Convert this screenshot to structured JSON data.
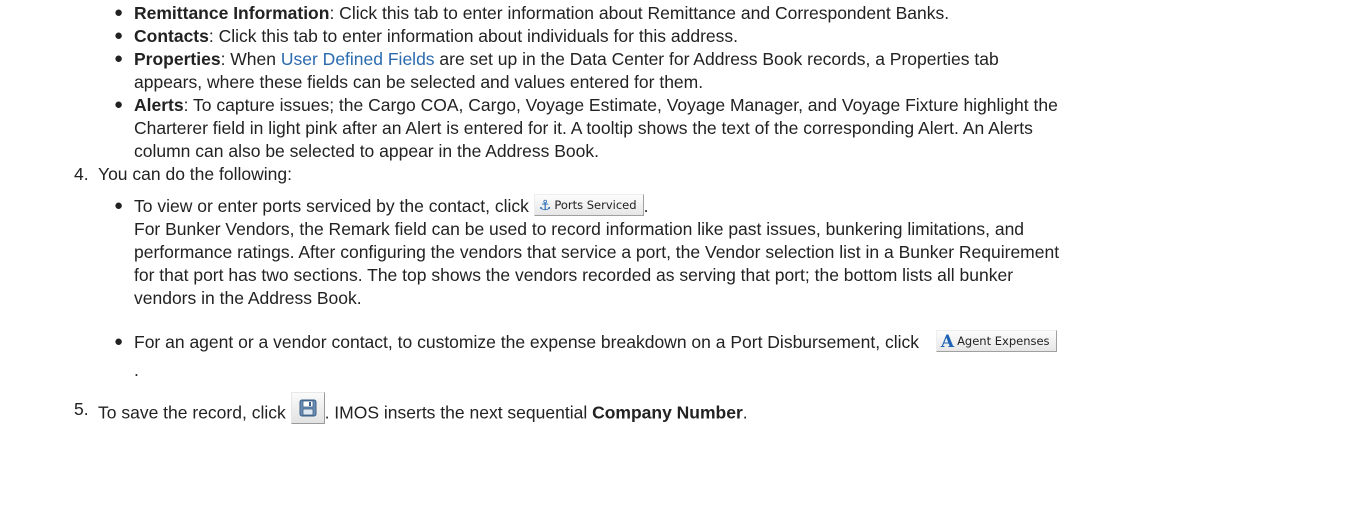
{
  "items": {
    "remittance": {
      "term": "Remittance Information",
      "text": ": Click this tab to enter information about Remittance and Correspondent Banks."
    },
    "contacts": {
      "term": "Contacts",
      "text": ": Click this tab to enter information about individuals for this address."
    },
    "properties": {
      "term": "Properties",
      "text_before_link": ": When ",
      "link": "User Defined Fields",
      "text_after_link": " are set up in the Data Center for Address Book records, a Properties tab",
      "line2": "appears, where these fields can be selected and values entered for them."
    },
    "alerts": {
      "term": "Alerts",
      "line1": ": To capture issues; the Cargo COA, Cargo, Voyage Estimate, Voyage Manager, and Voyage Fixture highlight the",
      "line2": "Charterer field in light pink after an Alert is entered for it. A tooltip shows the text of the corresponding Alert. An Alerts",
      "line3": "column can also be selected to appear in the Address Book."
    }
  },
  "step4": {
    "number": "4.",
    "text": "You can do the following:",
    "ports": {
      "text_before": "To view or enter ports serviced by the contact, click ",
      "button_label": "Ports Serviced",
      "text_after": ".",
      "para": [
        "For Bunker Vendors, the Remark field can be used to record information like past issues, bunkering limitations, and",
        "performance ratings. After configuring the vendors that service a port, the Vendor selection list in a Bunker Requirement",
        "for that port has two sections. The top shows the vendors recorded as serving that port; the bottom lists all bunker",
        "vendors in the Address Book."
      ]
    },
    "agent": {
      "text_before": "For an agent or a vendor contact, to customize the expense breakdown on a Port Disbursement, click ",
      "button_label": "Agent Expenses",
      "text_after": "."
    }
  },
  "step5": {
    "number": "5.",
    "text_before": "To save the record, click ",
    "text_mid": ". IMOS inserts the next sequential ",
    "term": "Company Number",
    "text_after": "."
  },
  "bullet_char": "●",
  "colors": {
    "link": "#2a6aae",
    "icon": "#1d62b5"
  }
}
